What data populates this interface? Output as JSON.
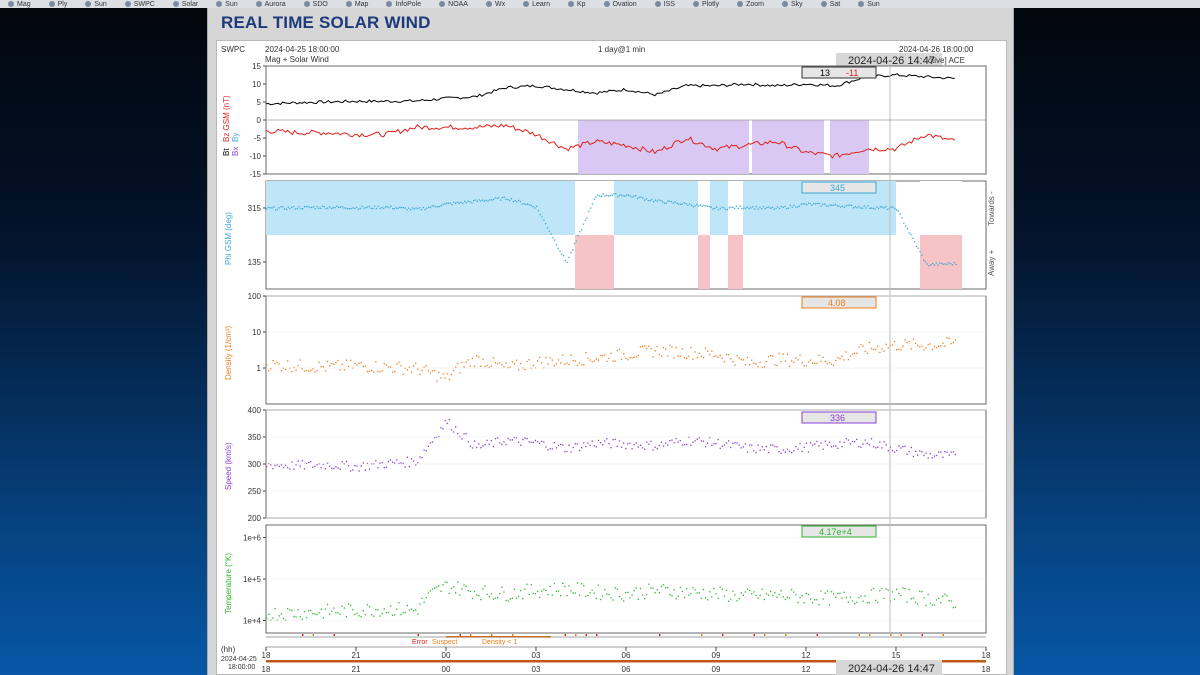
{
  "browser": {
    "bookmarks": [
      "Mag",
      "Ply",
      "Sun",
      "SWPC",
      "Solar",
      "Sun",
      "Aurora",
      "SDO",
      "Map",
      "InfoPole",
      "NOAA",
      "Wx",
      "Learn",
      "Kp",
      "Ovation",
      "ISS",
      "Plotly",
      "Zoom",
      "Sky",
      "Sat",
      "Sun"
    ]
  },
  "page": {
    "title": "REAL TIME SOLAR WIND"
  },
  "header": {
    "org": "SWPC",
    "start_time": "2024-04-25 18:00:00",
    "subtitle": "Mag + Solar Wind",
    "duration": "1 day@1 min",
    "end_time": "2024-04-26 18:00:00",
    "cursor_time": "2024-04-26 14:47",
    "source": "ctive] ACE"
  },
  "colors": {
    "bt": "#000000",
    "bz": "#e0201c",
    "phi": "#3aa7d8",
    "density": "#f07d1a",
    "speed": "#8a3fd6",
    "temperature": "#2fb52f",
    "southward_shade": "#d9c9f2",
    "toward_shade": "#bfe6f8",
    "away_shade": "#f6c3c6",
    "title": "#1d3a7a"
  },
  "chart_data": [
    {
      "panel": "magnetic_field",
      "type": "line",
      "ylabel_parts": [
        "Bt",
        "Bz GSM (nT)",
        "Bx",
        "By"
      ],
      "yticks": [
        "15",
        "10",
        "5",
        "0",
        "-5",
        "-10",
        "-15"
      ],
      "ylim": [
        -15,
        15
      ],
      "readout": {
        "bt": "13",
        "bz": "-11"
      },
      "series": [
        {
          "name": "Bt",
          "x": [
            0,
            1,
            2,
            3,
            4,
            5,
            6,
            7,
            8,
            9,
            10,
            11,
            12,
            13,
            14,
            15,
            16,
            17,
            18,
            19,
            20,
            21,
            22,
            23
          ],
          "values": [
            4.5,
            4.8,
            5,
            5.2,
            5.2,
            5.3,
            6,
            6.5,
            9,
            9.5,
            8.5,
            7.5,
            8.5,
            7,
            9.5,
            9.5,
            10,
            9.5,
            10,
            9.5,
            12,
            12.5,
            12,
            11.5
          ]
        },
        {
          "name": "Bz",
          "x": [
            0,
            1,
            2,
            3,
            4,
            5,
            6,
            7,
            8,
            9,
            10,
            11,
            12,
            13,
            14,
            15,
            16,
            17,
            18,
            19,
            20,
            21,
            22,
            23
          ],
          "values": [
            -3,
            -3.5,
            -3.5,
            -4,
            -4,
            -2,
            -2,
            -2,
            -1.5,
            -4,
            -8,
            -6,
            -7,
            -9,
            -5,
            -8,
            -7,
            -6,
            -9,
            -10,
            -8,
            -8,
            -4,
            -6
          ]
        }
      ]
    },
    {
      "panel": "phi",
      "type": "scatter",
      "ylabel": "Phi GSM (deg)",
      "yticks": [
        "315",
        "135"
      ],
      "ylim": [
        45,
        405
      ],
      "side_labels": [
        "Towards -",
        "Away +"
      ],
      "readout": "345",
      "x": [
        0,
        1,
        2,
        3,
        4,
        5,
        6,
        7,
        8,
        9,
        10,
        11,
        12,
        13,
        14,
        15,
        16,
        17,
        18,
        19,
        20,
        21,
        22,
        23
      ],
      "values": [
        315,
        318,
        320,
        318,
        320,
        312,
        330,
        340,
        350,
        320,
        135,
        360,
        360,
        340,
        330,
        315,
        320,
        315,
        330,
        325,
        320,
        315,
        128,
        132
      ]
    },
    {
      "panel": "density",
      "type": "scatter",
      "ylabel": "Density (1/cm³)",
      "yticks": [
        "100",
        "10",
        "1"
      ],
      "scale": "log",
      "ylim": [
        0.1,
        100
      ],
      "readout": "4.08",
      "x": [
        0,
        1,
        2,
        3,
        4,
        5,
        6,
        7,
        8,
        9,
        10,
        11,
        12,
        13,
        14,
        15,
        16,
        17,
        18,
        19,
        20,
        21,
        22,
        23
      ],
      "values": [
        1.3,
        1.2,
        1.1,
        1.2,
        1.1,
        1.0,
        0.5,
        1.8,
        1.0,
        1.5,
        1.7,
        2.0,
        2.5,
        3.2,
        2.8,
        2.5,
        1.4,
        1.8,
        1.7,
        1.7,
        3.5,
        4.5,
        4.5,
        5.0
      ]
    },
    {
      "panel": "speed",
      "type": "scatter",
      "ylabel": "Speed (km/s)",
      "yticks": [
        "400",
        "350",
        "300",
        "250",
        "200"
      ],
      "ylim": [
        200,
        400
      ],
      "readout": "336",
      "x": [
        0,
        1,
        2,
        3,
        4,
        5,
        6,
        7,
        8,
        9,
        10,
        11,
        12,
        13,
        14,
        15,
        16,
        17,
        18,
        19,
        20,
        21,
        22,
        23
      ],
      "values": [
        300,
        298,
        300,
        296,
        302,
        306,
        380,
        332,
        345,
        340,
        330,
        340,
        338,
        335,
        345,
        340,
        330,
        328,
        332,
        338,
        342,
        330,
        318,
        315
      ]
    },
    {
      "panel": "temperature",
      "type": "scatter",
      "ylabel": "Temperature (°K)",
      "yticks": [
        "1e+6",
        "1e+5",
        "1e+4"
      ],
      "scale": "log",
      "ylim": [
        5000,
        2000000
      ],
      "readout": "4.17e+4",
      "x": [
        0,
        1,
        2,
        3,
        4,
        5,
        6,
        7,
        8,
        9,
        10,
        11,
        12,
        13,
        14,
        15,
        16,
        17,
        18,
        19,
        20,
        21,
        22,
        23
      ],
      "values": [
        15000,
        16000,
        17000,
        18000,
        20000,
        18000,
        70000,
        50000,
        45000,
        55000,
        60000,
        50000,
        45000,
        55000,
        50000,
        45000,
        40000,
        42000,
        38000,
        35000,
        40000,
        45000,
        35000,
        28000
      ]
    }
  ],
  "status_legend": {
    "items": [
      "Error",
      "Suspect",
      "Density < 1"
    ]
  },
  "x_axis": {
    "label": "(hh)",
    "ticks": [
      "18",
      "21",
      "00",
      "03",
      "06",
      "09",
      "12",
      "15",
      "18"
    ],
    "start_date": "2024-04-25",
    "start_clock": "18:00:00",
    "cursor_readout": "2024-04-26 14:47"
  }
}
